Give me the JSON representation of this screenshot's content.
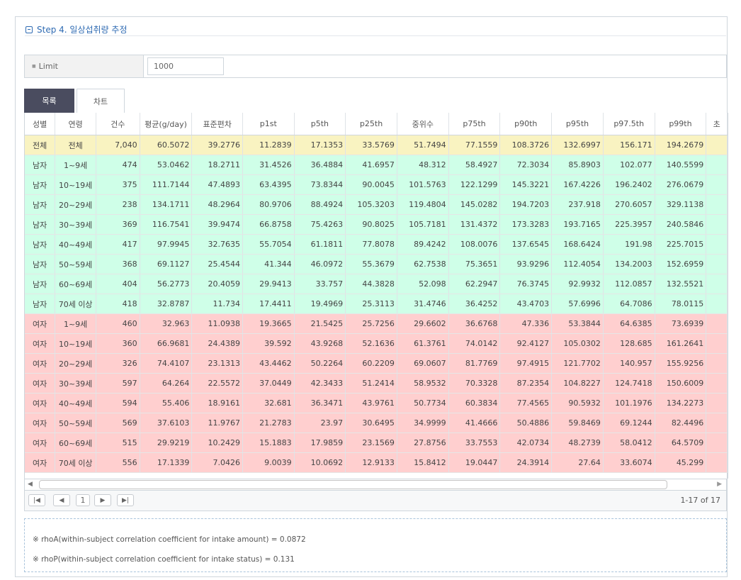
{
  "step": {
    "title": "Step 4. 일상섭취량 추정"
  },
  "limit": {
    "label": "Limit",
    "value": "1000"
  },
  "tabs": [
    {
      "label": "목록"
    },
    {
      "label": "차트"
    }
  ],
  "grid": {
    "headers": [
      "성별",
      "연령",
      "건수",
      "평균(g/day)",
      "표준편차",
      "p1st",
      "p5th",
      "p25th",
      "중위수",
      "p75th",
      "p90th",
      "p95th",
      "p97.5th",
      "p99th",
      "초"
    ],
    "rows": [
      [
        "전체",
        "전체",
        "7,040",
        "60.5072",
        "39.2776",
        "11.2839",
        "17.1353",
        "33.5769",
        "51.7494",
        "77.1559",
        "108.3726",
        "132.6997",
        "156.171",
        "194.2679"
      ],
      [
        "남자",
        "1~9세",
        "474",
        "53.0462",
        "18.2711",
        "31.4526",
        "36.4884",
        "41.6957",
        "48.312",
        "58.4927",
        "72.3034",
        "85.8903",
        "102.077",
        "140.5599"
      ],
      [
        "남자",
        "10~19세",
        "375",
        "111.7144",
        "47.4893",
        "63.4395",
        "73.8344",
        "90.0045",
        "101.5763",
        "122.1299",
        "145.3221",
        "167.4226",
        "196.2402",
        "276.0679"
      ],
      [
        "남자",
        "20~29세",
        "238",
        "134.1711",
        "48.2964",
        "80.9706",
        "88.4924",
        "105.3203",
        "119.4804",
        "145.0282",
        "194.7203",
        "237.918",
        "270.6057",
        "329.1138"
      ],
      [
        "남자",
        "30~39세",
        "369",
        "116.7541",
        "39.9474",
        "66.8758",
        "75.4263",
        "90.8025",
        "105.7181",
        "131.4372",
        "173.3283",
        "193.7165",
        "225.3957",
        "240.5846"
      ],
      [
        "남자",
        "40~49세",
        "417",
        "97.9945",
        "32.7635",
        "55.7054",
        "61.1811",
        "77.8078",
        "89.4242",
        "108.0076",
        "137.6545",
        "168.6424",
        "191.98",
        "225.7015"
      ],
      [
        "남자",
        "50~59세",
        "368",
        "69.1127",
        "25.4544",
        "41.344",
        "46.0972",
        "55.3679",
        "62.7538",
        "75.3651",
        "93.9296",
        "112.4054",
        "134.2003",
        "152.6959"
      ],
      [
        "남자",
        "60~69세",
        "404",
        "56.2773",
        "20.4059",
        "29.9413",
        "33.757",
        "44.3828",
        "52.098",
        "62.2947",
        "76.3745",
        "92.9932",
        "112.0857",
        "132.5521"
      ],
      [
        "남자",
        "70세 이상",
        "418",
        "32.8787",
        "11.734",
        "17.4411",
        "19.4969",
        "25.3113",
        "31.4746",
        "36.4252",
        "43.4703",
        "57.6996",
        "64.7086",
        "78.0115"
      ],
      [
        "여자",
        "1~9세",
        "460",
        "32.963",
        "11.0938",
        "19.3665",
        "21.5425",
        "25.7256",
        "29.6602",
        "36.6768",
        "47.336",
        "53.3844",
        "64.6385",
        "73.6939"
      ],
      [
        "여자",
        "10~19세",
        "360",
        "66.9681",
        "24.4389",
        "39.592",
        "43.9268",
        "52.1636",
        "61.3761",
        "74.0142",
        "92.4127",
        "105.0302",
        "128.685",
        "161.2641"
      ],
      [
        "여자",
        "20~29세",
        "326",
        "74.4107",
        "23.1313",
        "43.4462",
        "50.2264",
        "60.2209",
        "69.0607",
        "81.7769",
        "97.4915",
        "121.7702",
        "140.957",
        "155.9256"
      ],
      [
        "여자",
        "30~39세",
        "597",
        "64.264",
        "22.5572",
        "37.0449",
        "42.3433",
        "51.2414",
        "58.9532",
        "70.3328",
        "87.2354",
        "104.8227",
        "124.7418",
        "150.6009"
      ],
      [
        "여자",
        "40~49세",
        "594",
        "55.406",
        "18.9161",
        "32.681",
        "36.3471",
        "43.9761",
        "50.7734",
        "60.3834",
        "77.4565",
        "90.5932",
        "101.1976",
        "134.2273"
      ],
      [
        "여자",
        "50~59세",
        "569",
        "37.6103",
        "11.9767",
        "21.2783",
        "23.97",
        "30.6495",
        "34.9999",
        "41.4666",
        "50.4886",
        "59.8469",
        "69.1244",
        "82.4496"
      ],
      [
        "여자",
        "60~69세",
        "515",
        "29.9219",
        "10.2429",
        "15.1883",
        "17.9859",
        "23.1569",
        "27.8756",
        "33.7553",
        "42.0734",
        "48.2739",
        "58.0412",
        "64.5709"
      ],
      [
        "여자",
        "70세 이상",
        "556",
        "17.1339",
        "7.0426",
        "9.0039",
        "10.0692",
        "12.9133",
        "15.8412",
        "19.0447",
        "24.3914",
        "27.64",
        "33.6074",
        "45.299"
      ]
    ]
  },
  "pager": {
    "current_page": "1",
    "info": "1-17 of 17"
  },
  "notes": [
    "※ rhoA(within-subject correlation coefficient for intake amount) = 0.0872",
    "※ rhoP(within-subject correlation coefficient for intake status) = 0.131"
  ],
  "colors": {
    "total_row": "#f9f3c1",
    "male_rows": "#cfffe8",
    "female_rows": "#ffcfcf",
    "active_tab": "#4a4c5f",
    "title_blue": "#2f6bb3"
  },
  "icons": {
    "collapse": "minus-square-icon",
    "scroll_left": "arrow-left-icon",
    "scroll_right": "arrow-right-icon",
    "first": "first-page-icon",
    "prev": "prev-page-icon",
    "next": "next-page-icon",
    "last": "last-page-icon"
  }
}
